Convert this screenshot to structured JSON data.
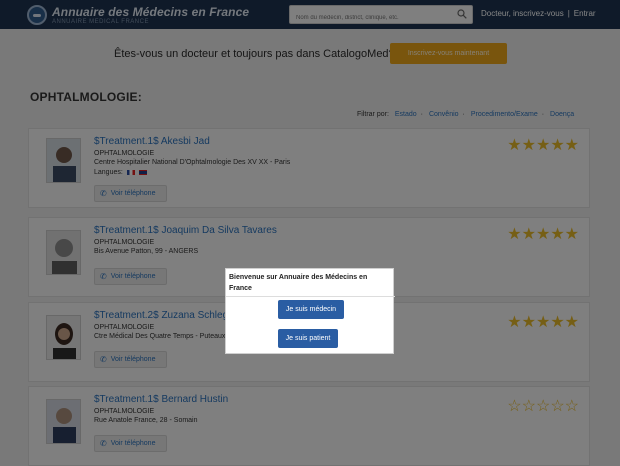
{
  "header": {
    "title": "Annuaire des Médecins en France",
    "subtitle": "ANNUAIRE MEDICAL FRANCE",
    "search_placeholder": "Nom du médecin, district, clinique, etc.",
    "signup_link": "Docteur, inscrivez-vous",
    "separator": "|",
    "login_link": "Entrar"
  },
  "banner": {
    "text": "Êtes-vous un docteur et toujours pas dans CatalogoMed?",
    "button_label": "Inscrivez-vous maintenant"
  },
  "section_title": "OPHTALMOLOGIE:",
  "filters": {
    "label": "Filtrar por:",
    "items": [
      "Estado",
      "Convênio",
      "Procedimento/Exame",
      "Doença"
    ],
    "separator": "·"
  },
  "icons": {
    "search": "search-icon",
    "phone": "phone-icon",
    "star": "star-icon",
    "logo": "logo-icon"
  },
  "colors": {
    "header_bg": "#1d3350",
    "link": "#2a6fb8",
    "accent_orange": "#e9a319",
    "star": "#e3b62a",
    "modal_button": "#2a5da3"
  },
  "doctors": [
    {
      "name": "$Treatment.1$ Akesbi Jad",
      "specialty": "OPHTALMOLOGIE",
      "address": "Centre Hospitalier National D'Ophtalmologie Des XV XX - Paris",
      "languages_label": "Langues:",
      "phone_label": "Voir téléphone",
      "rating": 5
    },
    {
      "name": "$Treatment.1$ Joaquim Da Silva Tavares",
      "specialty": "OPHTALMOLOGIE",
      "address": "Bis Avenue Patton, 99 - ANGERS",
      "phone_label": "Voir téléphone",
      "rating": 5
    },
    {
      "name": "$Treatment.2$ Zuzana Schlegel",
      "specialty": "OPHTALMOLOGIE",
      "address": "Ctre Médical Des Quatre Temps - Puteaux",
      "phone_label": "Voir téléphone",
      "rating": 5
    },
    {
      "name": "$Treatment.1$ Bernard Hustin",
      "specialty": "OPHTALMOLOGIE",
      "address": "Rue Anatole France, 28 - Somain",
      "phone_label": "Voir téléphone",
      "rating": 0
    }
  ],
  "modal": {
    "title": "Bienvenue sur Annuaire des Médecins en France",
    "doctor_button": "Je suis médecin",
    "patient_button": "Je suis patient"
  }
}
